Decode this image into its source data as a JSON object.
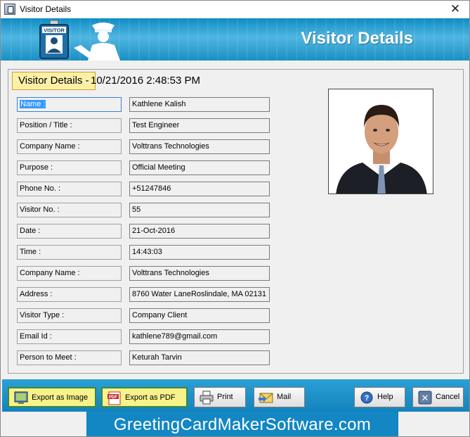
{
  "window": {
    "title": "Visitor Details",
    "close_glyph": "✕"
  },
  "banner": {
    "title": "Visitor Details",
    "badge_text": "VISITOR"
  },
  "header": {
    "label": "Visitor Details -",
    "timestamp": "10/21/2016 2:48:53 PM"
  },
  "fields": [
    {
      "label": "Name :",
      "value": "Kathlene Kalish"
    },
    {
      "label": "Position / Title :",
      "value": "Test Engineer"
    },
    {
      "label": "Company Name :",
      "value": "Volttrans Technologies"
    },
    {
      "label": "Purpose :",
      "value": "Official Meeting"
    },
    {
      "label": "Phone No. :",
      "value": "+51247846"
    },
    {
      "label": "Visitor No. :",
      "value": "55"
    },
    {
      "label": "Date :",
      "value": "21-Oct-2016"
    },
    {
      "label": "Time :",
      "value": "14:43:03"
    },
    {
      "label": "Company Name :",
      "value": "Volttrans Technologies"
    },
    {
      "label": "Address :",
      "value": "8760 Water LaneRoslindale, MA 02131"
    },
    {
      "label": "Visitor Type :",
      "value": "Company Client"
    },
    {
      "label": "Email Id :",
      "value": "kathlene789@gmail.com"
    },
    {
      "label": "Person to Meet :",
      "value": "Keturah Tarvin"
    }
  ],
  "buttons": {
    "export_image": "Export as Image",
    "export_pdf": "Export as PDF",
    "pdf_badge": "PDF",
    "print": "Print",
    "mail": "Mail",
    "help": "Help",
    "help_glyph": "?",
    "cancel": "Cancel",
    "cancel_glyph": "✕"
  },
  "watermark": "GreetingCardMakerSoftware.com",
  "colors": {
    "banner": "#1a8fc3",
    "highlight": "#fbf0a8",
    "selection": "#3399ff",
    "bottom_bar": "#1483bd"
  }
}
